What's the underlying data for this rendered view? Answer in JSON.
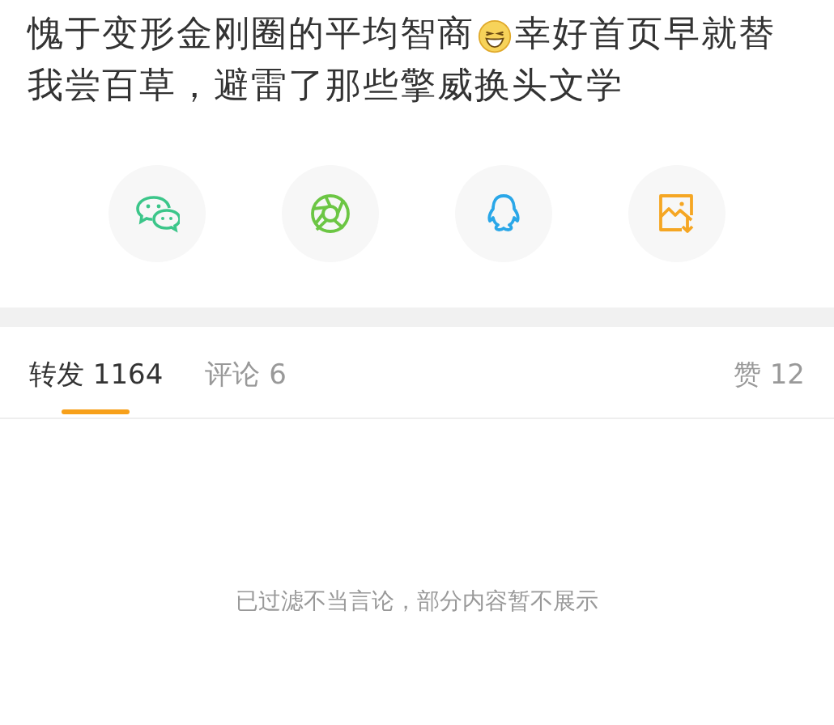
{
  "post": {
    "text_before_emoji": "愧于变形金刚圈的平均智商",
    "text_after_emoji": "幸好首页早就替",
    "second_line": "我尝百草，避雷了那些擎威换头文学"
  },
  "share_buttons": [
    {
      "kind": "chat"
    },
    {
      "kind": "aperture"
    },
    {
      "kind": "penguin"
    },
    {
      "kind": "save-image"
    }
  ],
  "tabs": [
    {
      "label": "转发 1164",
      "selected": true
    },
    {
      "label": "评论 6",
      "selected": false
    }
  ],
  "likes": "赞 12",
  "notice": "已过滤不当言论，部分内容暂不展示"
}
